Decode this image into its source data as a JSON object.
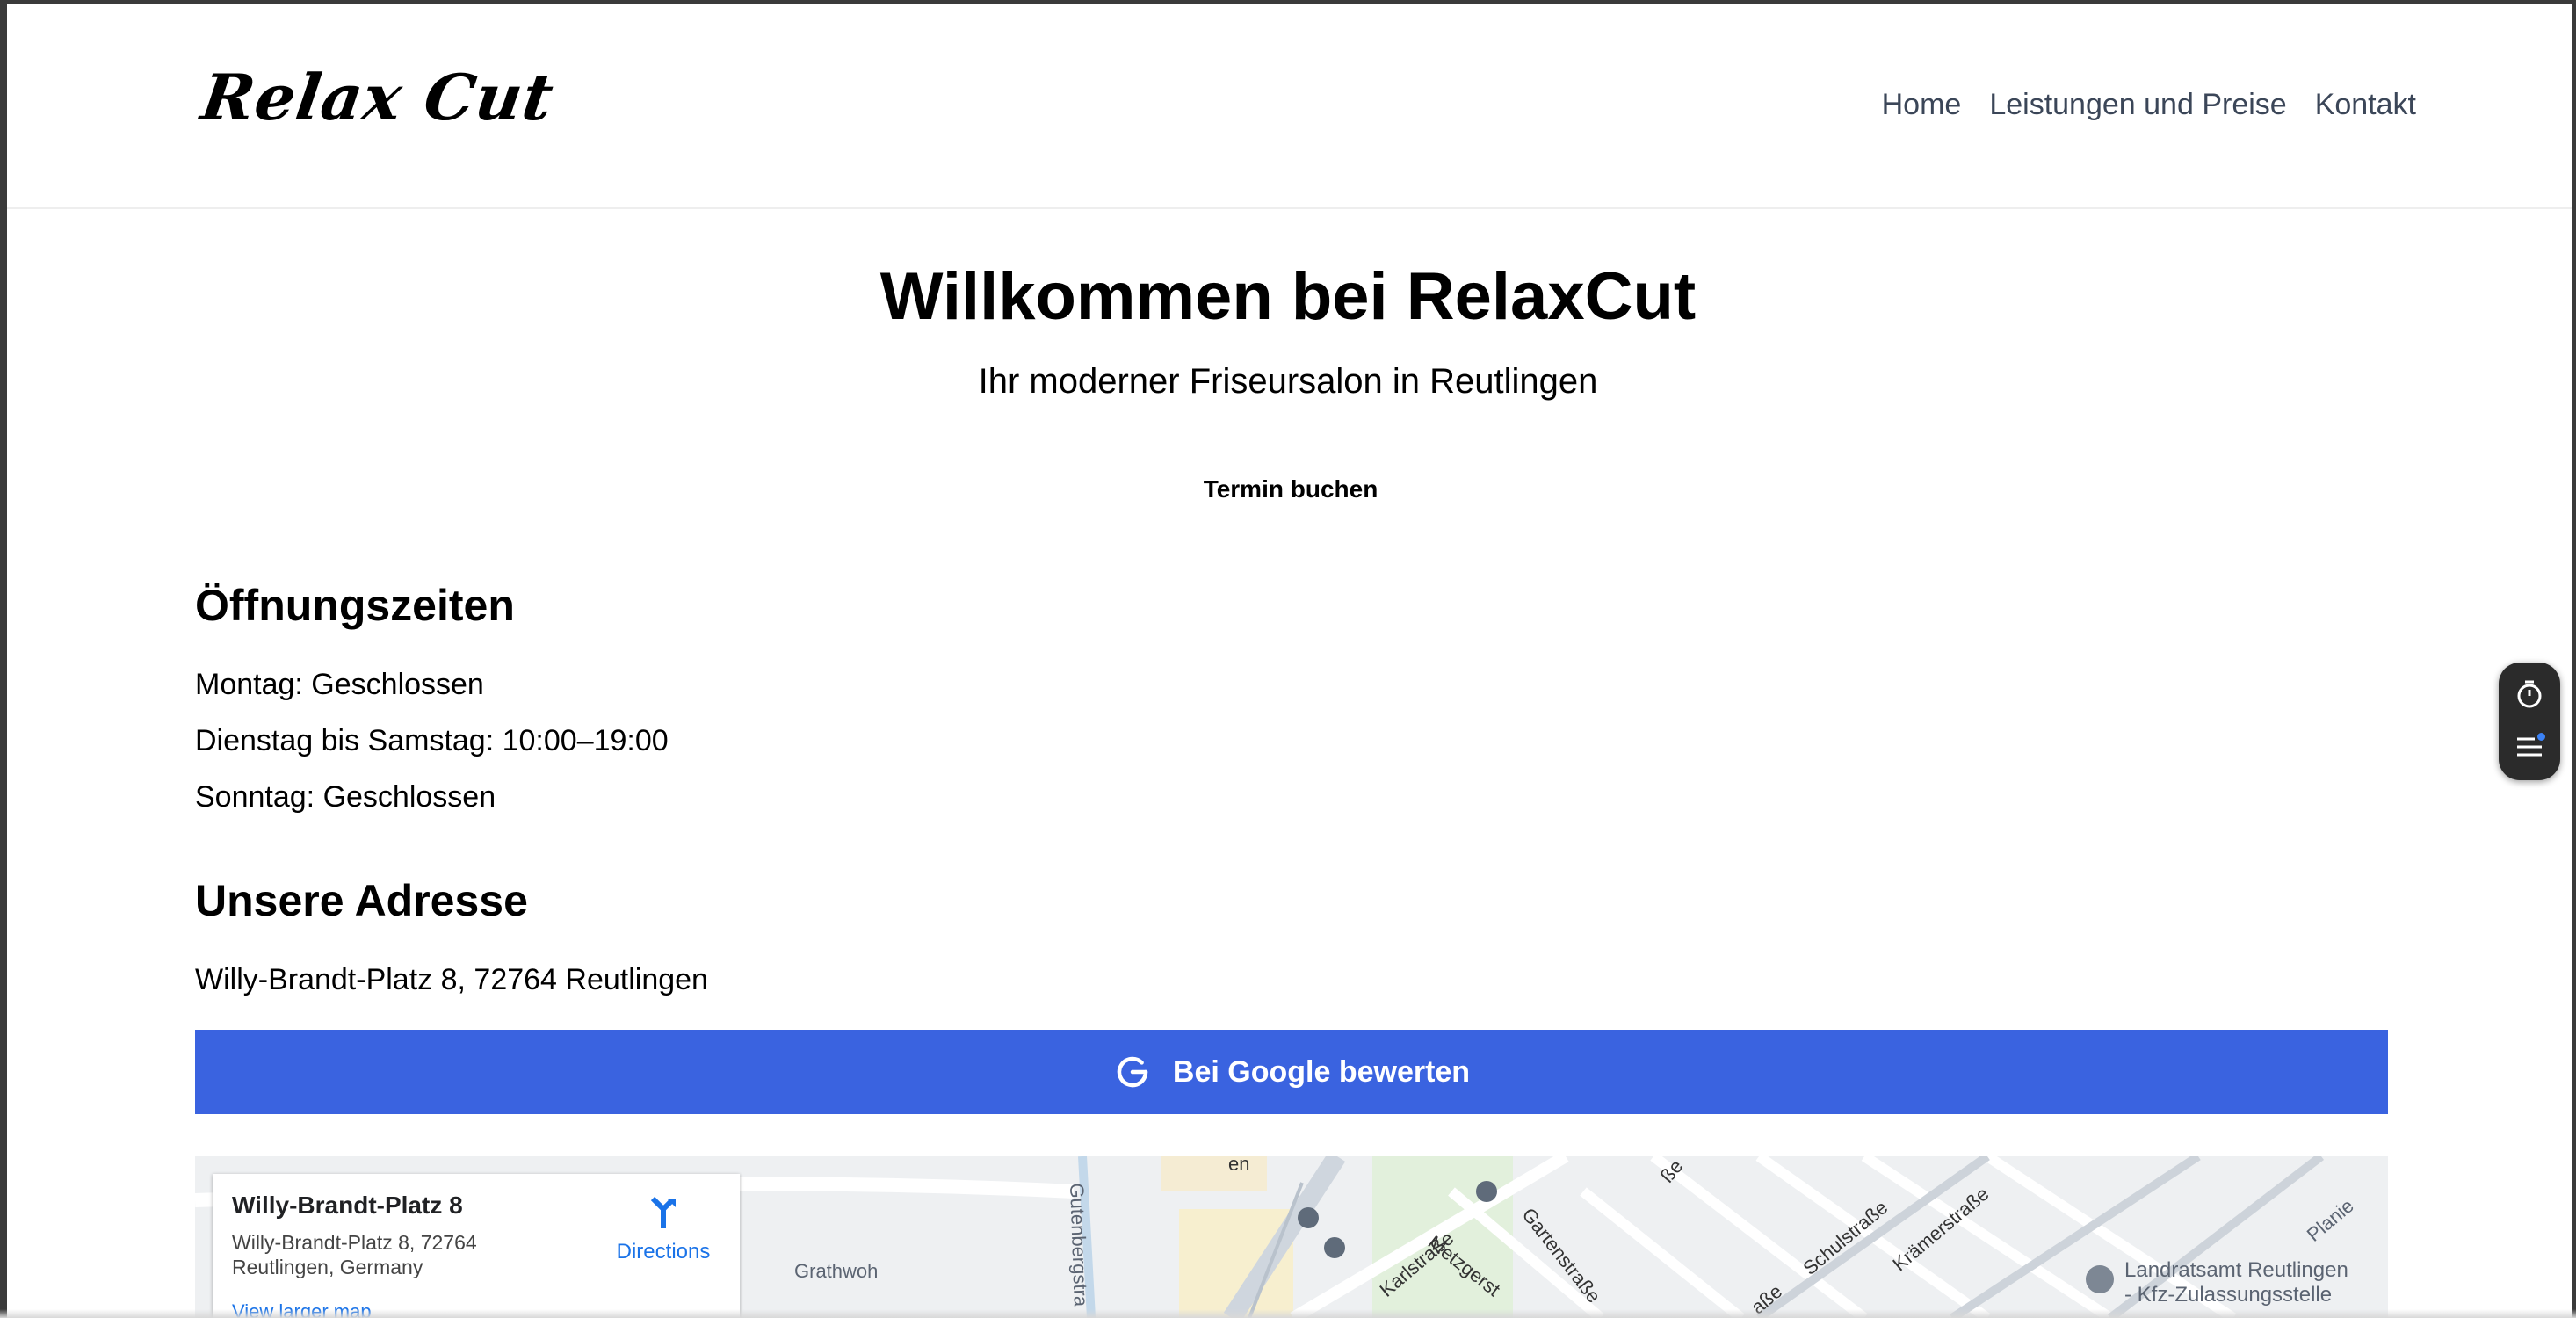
{
  "logo": {
    "text": "Relax Cut"
  },
  "nav": {
    "items": [
      "Home",
      "Leistungen und Preise",
      "Kontakt"
    ]
  },
  "hero": {
    "title": "Willkommen bei RelaxCut",
    "subtitle": "Ihr moderner Friseursalon in Reutlingen",
    "button": "Termin buchen"
  },
  "hours": {
    "heading": "Öffnungszeiten",
    "lines": [
      "Montag: Geschlossen",
      "Dienstag bis Samstag: 10:00–19:00",
      "Sonntag: Geschlossen"
    ]
  },
  "address": {
    "heading": "Unsere Adresse",
    "text": "Willy-Brandt-Platz 8, 72764 Reutlingen"
  },
  "review_button": {
    "label": "Bei Google bewerten",
    "icon": "google-icon",
    "color": "#3a63e0"
  },
  "map": {
    "card": {
      "title": "Willy-Brandt-Platz 8",
      "address": "Willy-Brandt-Platz 8, 72764 Reutlingen, Germany",
      "directions": "Directions",
      "larger_map": "View larger map"
    },
    "labels": [
      "Gutenbergstra",
      "Grathwoh",
      "Karlstraße",
      "Metzgerst",
      "Gartenstraße",
      "Schulstraße",
      "Krämerstraße",
      "Planie",
      "Landratsamt Reutlingen",
      "- Kfz-Zulassungsstelle",
      "en",
      "aße",
      "ße"
    ]
  },
  "widget": {
    "icons": [
      "timer-icon",
      "list-icon"
    ]
  }
}
